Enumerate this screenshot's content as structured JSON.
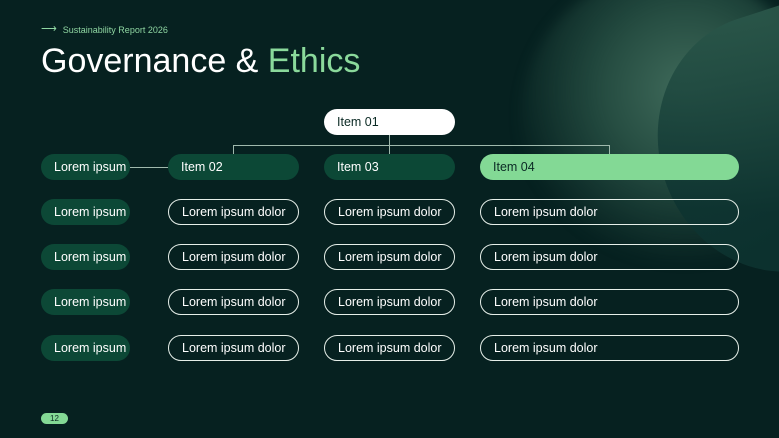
{
  "header": {
    "eyebrow": "Sustainability Report 2026"
  },
  "title": {
    "main": "Governance & ",
    "accent": "Ethics"
  },
  "chart": {
    "root": "Item 01",
    "columns": [
      "Item 02",
      "Item 03",
      "Item 04"
    ],
    "row_label": "Lorem ipsum",
    "cell": "Lorem ipsum dolor"
  },
  "page_number": "12",
  "colors": {
    "background": "#062120",
    "accent": "#83d995",
    "dark_pill": "#0c4836"
  }
}
